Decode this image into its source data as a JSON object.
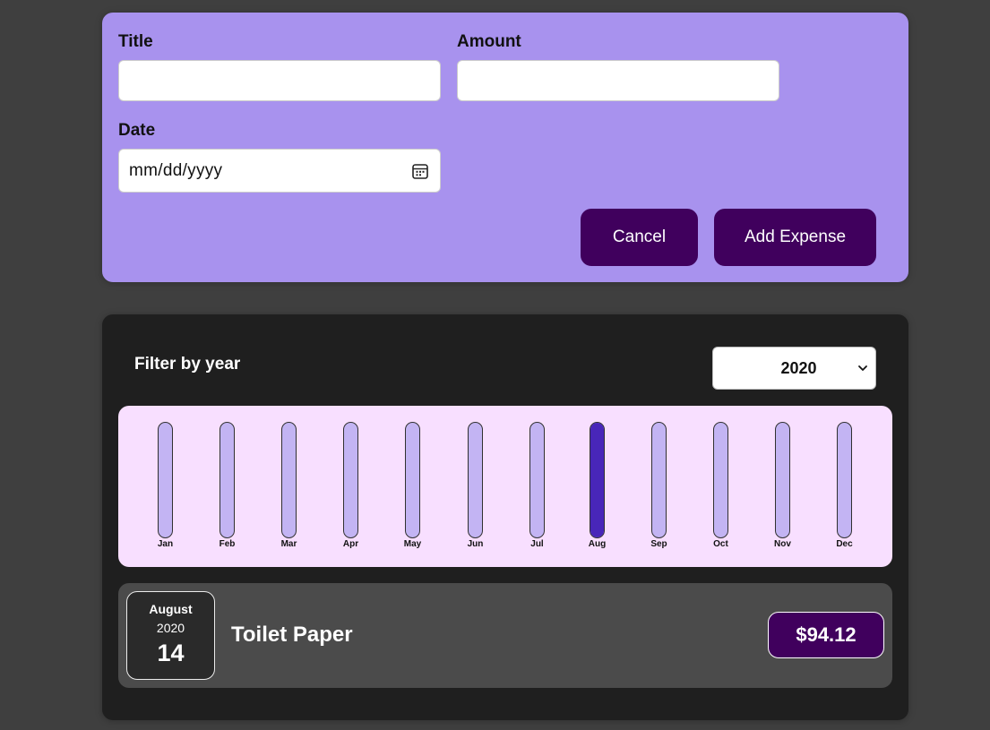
{
  "form": {
    "title_label": "Title",
    "title_value": "",
    "amount_label": "Amount",
    "amount_value": "",
    "date_label": "Date",
    "date_placeholder": "mm/dd/yyyy",
    "calendar_icon": "calendar-icon",
    "cancel_label": "Cancel",
    "submit_label": "Add Expense"
  },
  "filter": {
    "label": "Filter by year",
    "selected_year": "2020",
    "chevron_icon": "chevron-down-icon"
  },
  "chart_data": {
    "type": "bar",
    "categories": [
      "Jan",
      "Feb",
      "Mar",
      "Apr",
      "May",
      "Jun",
      "Jul",
      "Aug",
      "Sep",
      "Oct",
      "Nov",
      "Dec"
    ],
    "values": [
      0,
      0,
      0,
      0,
      0,
      0,
      0,
      94.12,
      0,
      0,
      0,
      0
    ],
    "max_value": 94.12,
    "title": "",
    "xlabel": "",
    "ylabel": ""
  },
  "expenses": [
    {
      "month": "August",
      "year": "2020",
      "day": "14",
      "title": "Toilet Paper",
      "amount": "$94.12"
    }
  ],
  "colors": {
    "page_background": "#3f3f3f",
    "form_background": "#a892ee",
    "button_background": "#40005d",
    "card_background": "#1f1f1f",
    "chart_background": "#f8dfff",
    "bar_track": "#c3b4f3",
    "bar_fill": "#4826b9",
    "expense_item_background": "#4b4b4b"
  }
}
